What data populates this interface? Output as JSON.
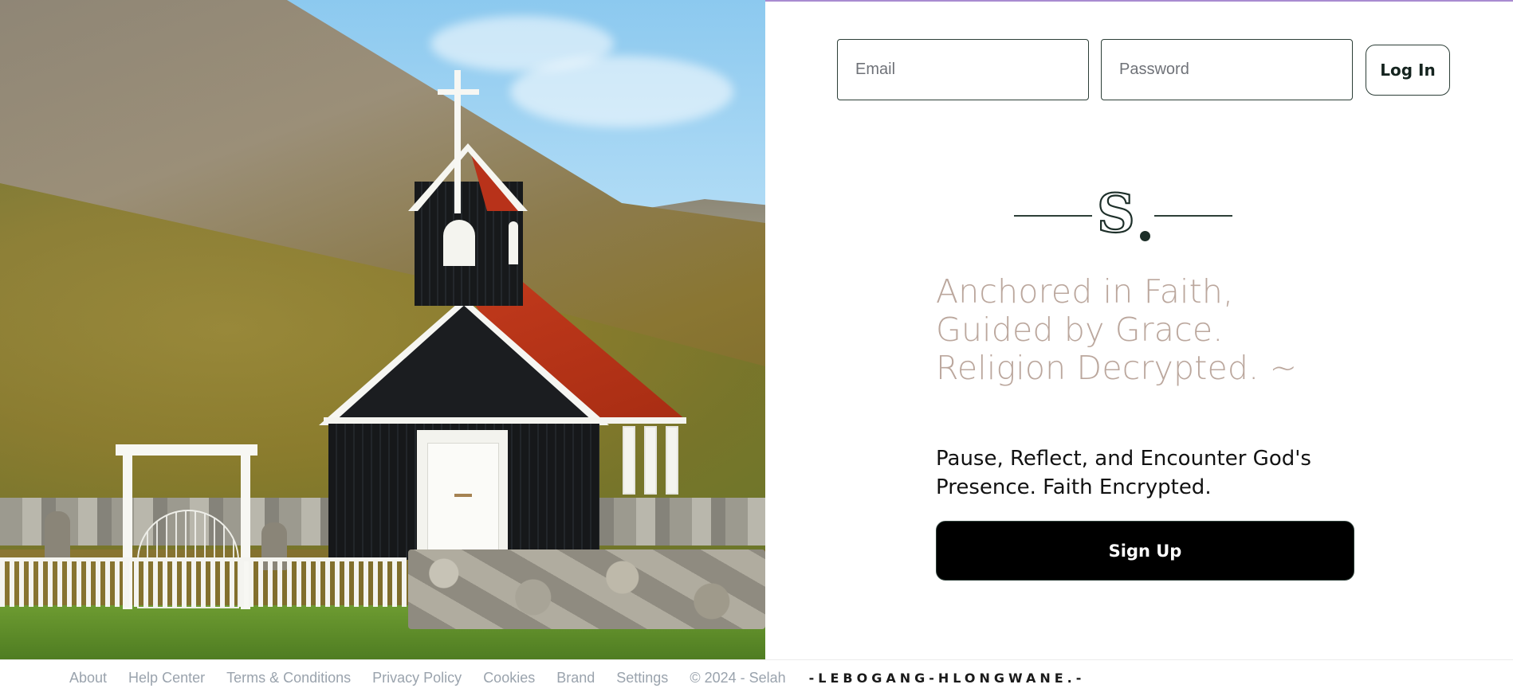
{
  "hero": {
    "image_alt": "Black wooden church with red roof and white cross in a mountain valley"
  },
  "login": {
    "email_placeholder": "Email",
    "password_placeholder": "Password",
    "login_label": "Log In"
  },
  "brand": {
    "logo_letter": "S"
  },
  "main": {
    "tagline": "Anchored in Faith, Guided by Grace. Religion Decrypted. ~",
    "subtext": "Pause, Reflect, and Encounter God's Presence. Faith Encrypted.",
    "signup_label": "Sign Up"
  },
  "footer": {
    "links": [
      "About",
      "Help Center",
      "Terms & Conditions",
      "Privacy Policy",
      "Cookies",
      "Brand",
      "Settings"
    ],
    "copyright": "© 2024 - Selah",
    "signature": "-LEBOGANG-HLONGWANE.-"
  },
  "colors": {
    "accent_line": "#a98bd0",
    "brand_dark": "#1d2f29",
    "tagline": "#bba79d",
    "footer_text": "#9aa3ad",
    "button_bg": "#000000"
  }
}
